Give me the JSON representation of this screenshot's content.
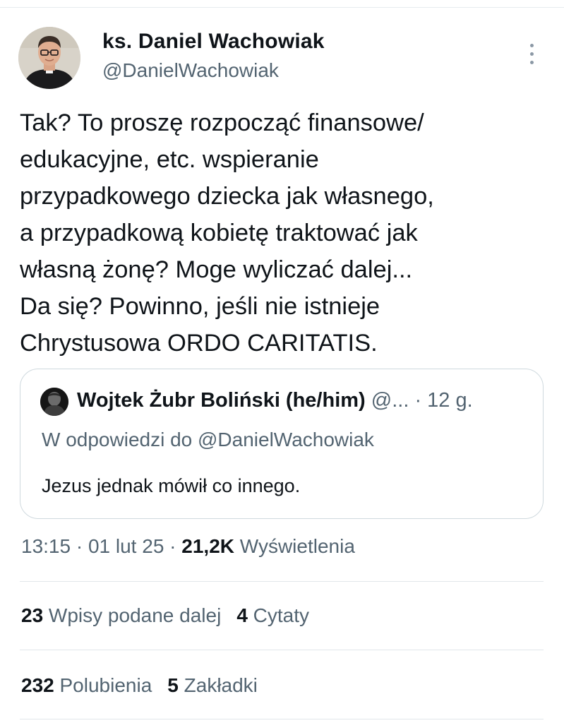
{
  "author": {
    "name": "ks. Daniel Wachowiak",
    "handle": "@DanielWachowiak"
  },
  "tweet": {
    "lines": [
      "Tak? To proszę rozpocząć finansowe/",
      "edukacyjne, etc. wspieranie",
      "przypadkowego dziecka jak własnego,",
      "a przypadkową kobietę traktować jak",
      "własną żonę?  Moge wyliczać dalej...",
      "Da się? Powinno, jeśli nie istnieje",
      "Chrystusowa ORDO CARITATIS."
    ]
  },
  "quote": {
    "name": "Wojtek Żubr Boliński (he/him)",
    "meta": " @... · 12 g.",
    "reply_to": "W odpowiedzi do @DanielWachowiak",
    "text": "Jezus jednak mówił co innego."
  },
  "meta": {
    "time": "13:15",
    "separator": " · ",
    "date": "01 lut 25",
    "views": "21,2K",
    "views_label": " Wyświetlenia"
  },
  "stats": {
    "reposts": {
      "count": "23",
      "label": " Wpisy podane dalej"
    },
    "quotes": {
      "count": "4",
      "label": " Cytaty"
    },
    "likes": {
      "count": "232",
      "label": " Polubienia"
    },
    "bookmarks": {
      "count": "5",
      "label": " Zakładki"
    }
  },
  "icons": {
    "more": "more-vertical-icon"
  },
  "colors": {
    "text": "#0f1419",
    "secondary": "#536471",
    "border": "#cfd9de"
  }
}
